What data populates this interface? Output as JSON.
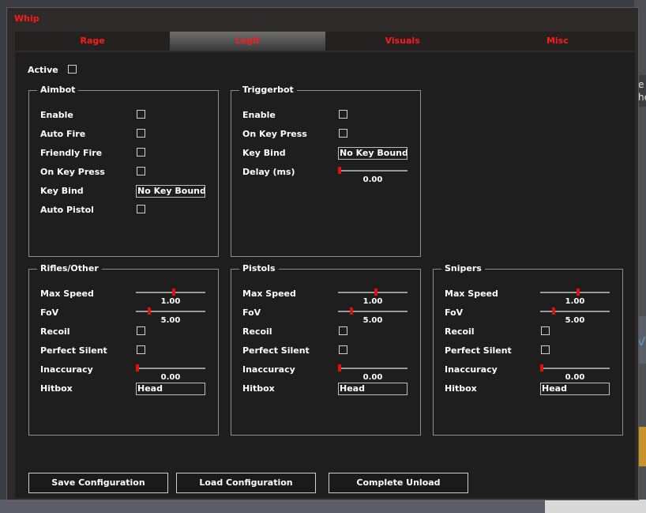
{
  "background": {
    "right_text_1": "e",
    "right_text_2": "he",
    "right_text_3": "ve"
  },
  "window": {
    "title": "Whip"
  },
  "tabs": [
    {
      "label": "Rage",
      "active": false
    },
    {
      "label": "Legit",
      "active": true
    },
    {
      "label": "Visuals",
      "active": false
    },
    {
      "label": "Misc",
      "active": false
    }
  ],
  "active": {
    "label": "Active",
    "checked": false
  },
  "aimbot": {
    "title": "Aimbot",
    "enable": "Enable",
    "auto_fire": "Auto Fire",
    "friendly_fire": "Friendly Fire",
    "on_key_press": "On Key Press",
    "key_bind": "Key Bind",
    "key_bind_value": "No Key Bound",
    "auto_pistol": "Auto Pistol"
  },
  "triggerbot": {
    "title": "Triggerbot",
    "enable": "Enable",
    "on_key_press": "On Key Press",
    "key_bind": "Key Bind",
    "key_bind_value": "No Key Bound",
    "delay_label": "Delay (ms)",
    "delay_value": "0.00",
    "delay_fraction": 0.0
  },
  "weapon_groups": {
    "rifles": {
      "title": "Rifles/Other",
      "max_speed": "Max Speed",
      "max_speed_value": "1.00",
      "max_speed_fraction": 0.55,
      "fov": "FoV",
      "fov_value": "5.00",
      "fov_fraction": 0.18,
      "recoil": "Recoil",
      "perfect_silent": "Perfect Silent",
      "inaccuracy": "Inaccuracy",
      "inaccuracy_value": "0.00",
      "inaccuracy_fraction": 0.0,
      "hitbox": "Hitbox",
      "hitbox_value": "Head"
    },
    "pistols": {
      "title": "Pistols",
      "max_speed": "Max Speed",
      "max_speed_value": "1.00",
      "max_speed_fraction": 0.55,
      "fov": "FoV",
      "fov_value": "5.00",
      "fov_fraction": 0.18,
      "recoil": "Recoil",
      "perfect_silent": "Perfect Silent",
      "inaccuracy": "Inaccuracy",
      "inaccuracy_value": "0.00",
      "inaccuracy_fraction": 0.0,
      "hitbox": "Hitbox",
      "hitbox_value": "Head"
    },
    "snipers": {
      "title": "Snipers",
      "max_speed": "Max Speed",
      "max_speed_value": "1.00",
      "max_speed_fraction": 0.55,
      "fov": "FoV",
      "fov_value": "5.00",
      "fov_fraction": 0.18,
      "recoil": "Recoil",
      "perfect_silent": "Perfect Silent",
      "inaccuracy": "Inaccuracy",
      "inaccuracy_value": "0.00",
      "inaccuracy_fraction": 0.0,
      "hitbox": "Hitbox",
      "hitbox_value": "Head"
    }
  },
  "buttons": {
    "save": "Save Configuration",
    "load": "Load Configuration",
    "unload": "Complete Unload"
  },
  "colors": {
    "accent": "#ff1a1a",
    "panel": "#1e1e1e",
    "frame": "#2f2a2a"
  }
}
